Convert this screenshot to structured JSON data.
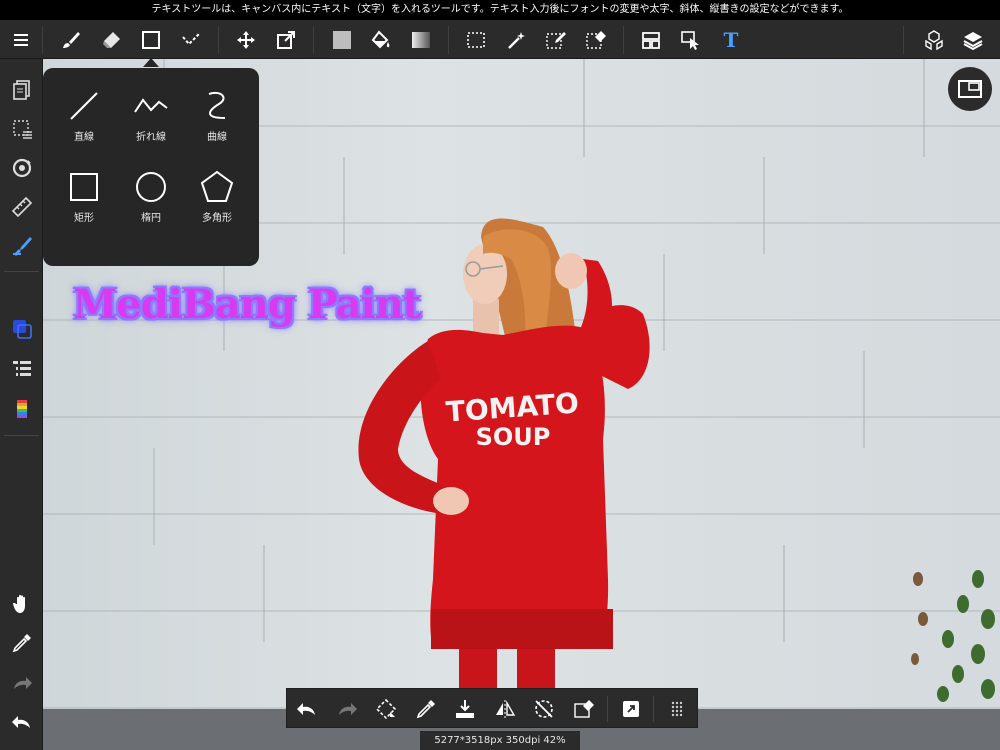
{
  "status_bar": {
    "hint": "テキストツールは、キャンバス内にテキスト（文字）を入れるツールです。テキスト入力後にフォントの変更や太字、斜体、縦書きの設定などができます。"
  },
  "toolbar": {
    "menu_icon": "hamburger-icon",
    "tools": [
      "brush-icon",
      "eraser-icon",
      "shape-icon",
      "dot-icon",
      "move-icon",
      "transform-icon",
      "fill-color-icon",
      "bucket-icon",
      "gradient-icon",
      "select-icon",
      "magic-wand-icon",
      "select-pen-icon",
      "select-eraser-icon",
      "snap-icon",
      "operate-icon",
      "text-icon"
    ],
    "right": [
      "3d-cube-icon",
      "layers-icon"
    ],
    "text_tool_glyph": "T"
  },
  "shape_popup": {
    "items": [
      {
        "label": "直線",
        "icon": "line-icon"
      },
      {
        "label": "折れ線",
        "icon": "polyline-icon"
      },
      {
        "label": "曲線",
        "icon": "curve-icon"
      },
      {
        "label": "矩形",
        "icon": "rectangle-icon"
      },
      {
        "label": "楕円",
        "icon": "ellipse-icon"
      },
      {
        "label": "多角形",
        "icon": "polygon-icon"
      }
    ]
  },
  "canvas": {
    "title_text": "MediBang Paint",
    "shirt_line1": "TOMATO",
    "shirt_line2": "SOUP"
  },
  "sidebar": {
    "top": [
      "pages-icon",
      "selection-icon",
      "rotate-icon",
      "ruler-icon",
      "pen-color-icon"
    ],
    "middle": [
      "color-layers-icon",
      "layer-list-icon",
      "color-palette-icon"
    ],
    "bottom": [
      "hand-icon",
      "eyedropper-icon",
      "redo-icon",
      "undo-icon"
    ]
  },
  "bottom_bar": {
    "buttons": [
      "undo-icon",
      "redo-icon",
      "transform-icon",
      "eyedropper-icon",
      "save-icon",
      "flip-icon",
      "rotate-reset-icon",
      "clear-icon",
      "quick-menu-icon",
      "grid-icon"
    ]
  },
  "info_bar": {
    "text": "5277*3518px 350dpi 42%"
  },
  "colors": {
    "accent": "#4a9eff",
    "title_fill": "#d63bf0",
    "title_glow": "#8c7cff",
    "shirt": "#d4161c"
  }
}
